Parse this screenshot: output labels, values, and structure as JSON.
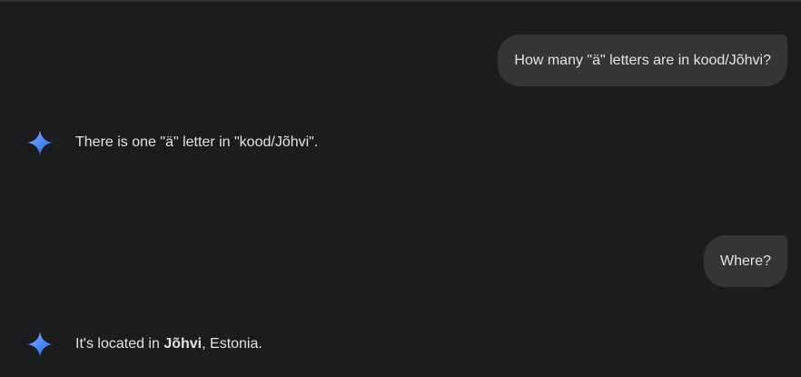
{
  "colors": {
    "background": "#1b1c1d",
    "user_bubble": "#333537",
    "text": "#e3e3e3",
    "spark_blue_light": "#8ab4f8",
    "spark_blue_dark": "#1a73e8"
  },
  "icons": {
    "model": "gemini-spark-icon"
  },
  "conversation": {
    "turn_1": {
      "user_prompt": "How many \"ä\" letters are in kood/Jõhvi?",
      "model_reply": "There is one \"ä\" letter in \"kood/Jõhvi\"."
    },
    "turn_2": {
      "user_prompt": "Where?",
      "model_reply_prefix": "It's located in ",
      "model_reply_bold": "Jõhvi",
      "model_reply_suffix": ", Estonia."
    }
  }
}
